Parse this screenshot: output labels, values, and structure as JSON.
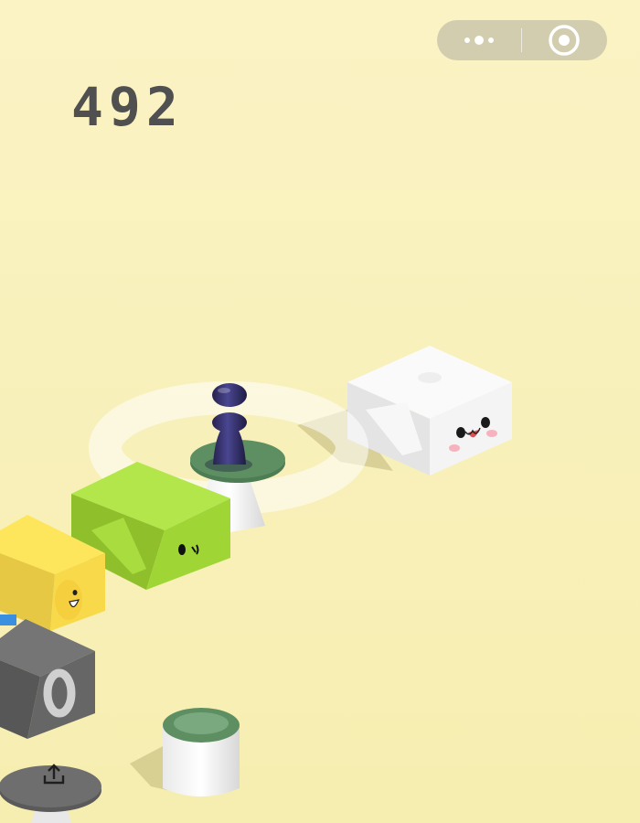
{
  "game": {
    "score": "492"
  },
  "capsule": {
    "more_icon": "more-dots-icon",
    "close_icon": "target-close-icon"
  },
  "colors": {
    "background_top": "#fbf3c4",
    "background_bottom": "#f6eeb0",
    "score_text": "#505050",
    "player": "#2f2c5e",
    "green_block": "#a6dc3a",
    "yellow_block": "#fde55c",
    "white_block": "#f2f2f2",
    "gray_block": "#6a6a6a",
    "green_pad": "#5d8f62"
  },
  "pieces": {
    "player": "player-pawn",
    "target_ring": "landing-ring",
    "platforms": [
      "white-cat-block",
      "green-pad-platform",
      "green-smile-block",
      "yellow-smile-block",
      "gray-ring-block",
      "green-top-cylinder",
      "gray-share-platform"
    ]
  }
}
